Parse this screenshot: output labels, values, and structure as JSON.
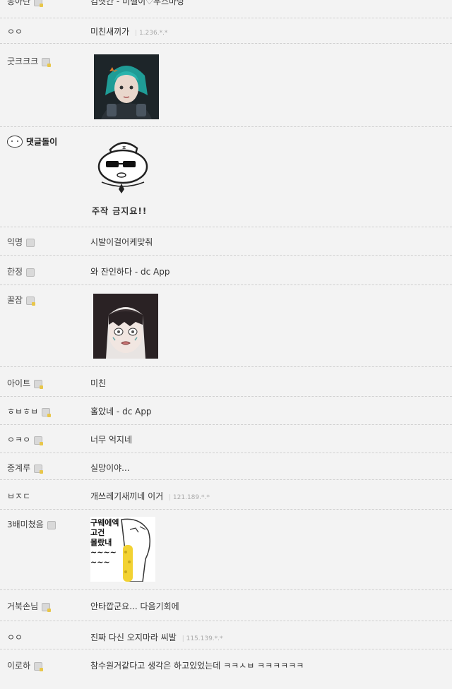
{
  "comments": [
    {
      "nick": "몽아란",
      "text": "김엣칸 - 미셸이♡우스마당",
      "ip": ""
    },
    {
      "nick": "ㅇㅇ",
      "text": "미친새끼가",
      "ip": "1.236.*.*"
    },
    {
      "nick": "굿크크크",
      "text": "",
      "ip": ""
    },
    {
      "nick": "댓글돌이",
      "text": "주작 금지요!!",
      "ip": ""
    },
    {
      "nick": "익명",
      "text": "시발이걸어케맞춰",
      "ip": ""
    },
    {
      "nick": "한정",
      "text": "와 잔인하다 - dc App",
      "ip": ""
    },
    {
      "nick": "꿀잠",
      "text": "",
      "ip": ""
    },
    {
      "nick": "아이트",
      "text": "미친",
      "ip": ""
    },
    {
      "nick": "ㅎㅂㅎㅂ",
      "text": "홀았네 - dc App",
      "ip": ""
    },
    {
      "nick": "ㅇㅋㅇ",
      "text": "너무 억지네",
      "ip": ""
    },
    {
      "nick": "중계루",
      "text": "실망이야...",
      "ip": ""
    },
    {
      "nick": "ㅂㅈㄷ",
      "text": "개쓰레기새끼네 이거",
      "ip": "121.189.*.*"
    },
    {
      "nick": "3배미쳤음",
      "text": "",
      "ip": ""
    },
    {
      "nick": "거북손님",
      "text": "안타깝군요... 다음기회에",
      "ip": ""
    },
    {
      "nick": "ㅇㅇ",
      "text": "진짜 다신 오지마라 씨발",
      "ip": "115.139.*.*"
    },
    {
      "nick": "이로하",
      "text": "참수원거같다고 생각은 하고있었는데 ㅋㅋㅅㅂ ㅋㅋㅋㅋㅋㅋ",
      "ip": ""
    }
  ],
  "dccon_text": {
    "lines": [
      "구웨에엑",
      "고건",
      "몰랐내",
      "~~~~",
      "~~~"
    ]
  }
}
